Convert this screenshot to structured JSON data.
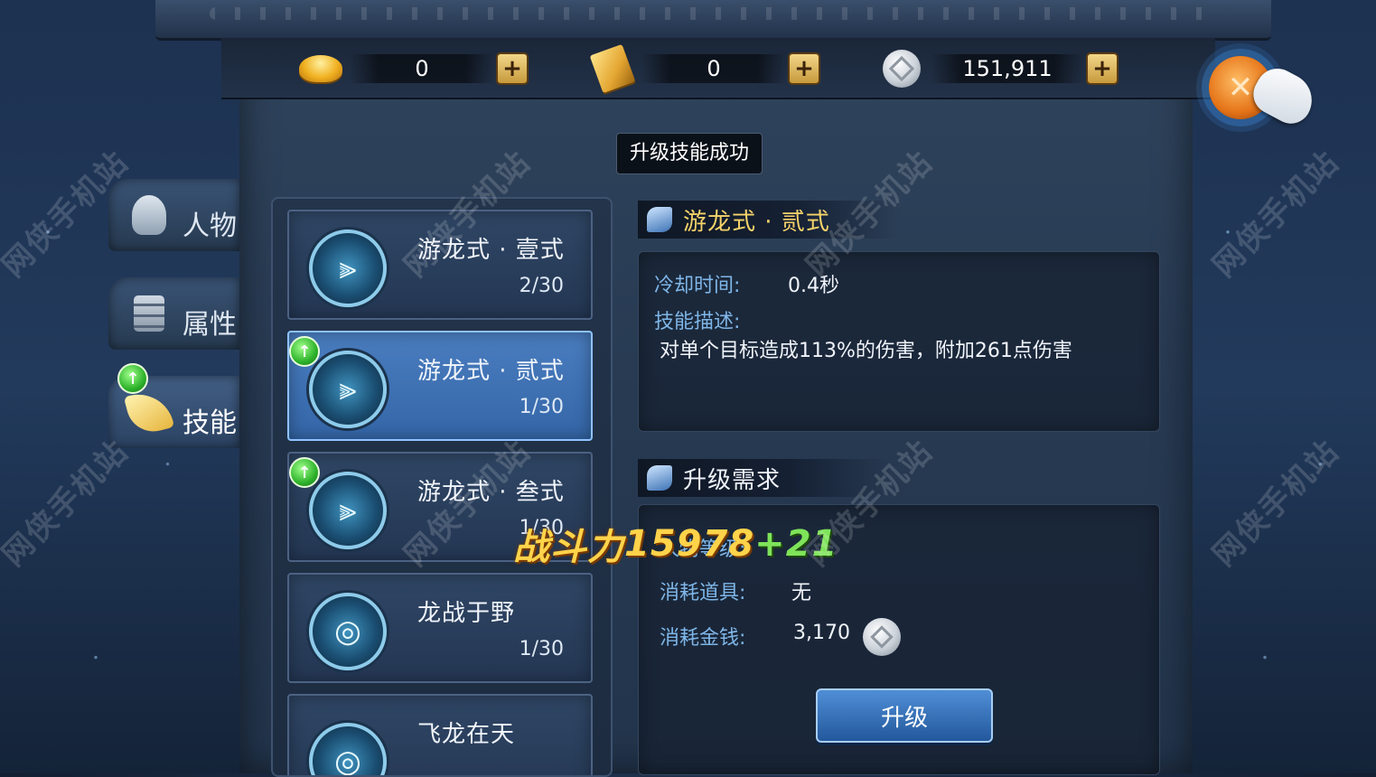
{
  "currencies": [
    {
      "icon": "gold-ingot-icon",
      "value": "0"
    },
    {
      "icon": "gold-ticket-icon",
      "value": "0"
    },
    {
      "icon": "silver-coin-icon",
      "value": "151,911"
    }
  ],
  "plus_label": "+",
  "toast": "升级技能成功",
  "tabs": [
    {
      "label": "人物",
      "icon": "helmet-icon"
    },
    {
      "label": "属性",
      "icon": "document-icon"
    },
    {
      "label": "技能",
      "icon": "feather-icon"
    }
  ],
  "skills": [
    {
      "name": "游龙式 · 壹式",
      "level": "2/30"
    },
    {
      "name": "游龙式 · 贰式",
      "level": "1/30"
    },
    {
      "name": "游龙式 · 叁式",
      "level": "1/30"
    },
    {
      "name": "龙战于野",
      "level": "1/30"
    },
    {
      "name": "飞龙在天",
      "level": ""
    }
  ],
  "detail": {
    "title": "游龙式 · 贰式",
    "cooldown_label": "冷却时间:",
    "cooldown_value": "0.4秒",
    "desc_label": "技能描述:",
    "desc_value": "对单个目标造成113%的伤害，附加261点伤害"
  },
  "requirements": {
    "title": "升级需求",
    "level_label": "人物等级:",
    "item_label": "消耗道具:",
    "item_value": "无",
    "money_label": "消耗金钱:",
    "money_value": "3,170"
  },
  "upgrade_button": "升级",
  "power_popup": {
    "label": "战斗力",
    "value": "15978",
    "delta": "+21"
  },
  "watermark": "网侠手机站",
  "close_icon": "close-icon"
}
